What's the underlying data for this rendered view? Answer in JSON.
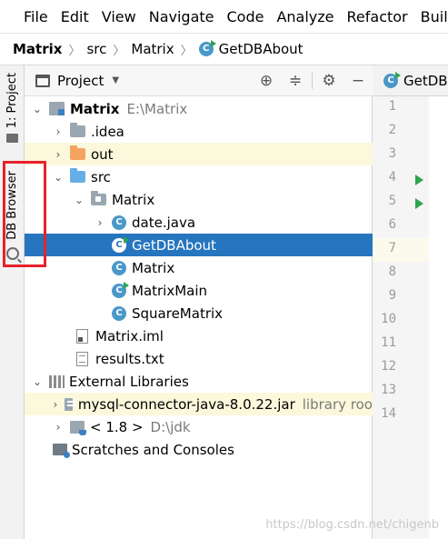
{
  "menubar": {
    "items": [
      {
        "label": "File"
      },
      {
        "label": "Edit"
      },
      {
        "label": "View"
      },
      {
        "label": "Navigate"
      },
      {
        "label": "Code"
      },
      {
        "label": "Analyze"
      },
      {
        "label": "Refactor"
      },
      {
        "label": "Build"
      }
    ]
  },
  "breadcrumb": {
    "items": [
      "Matrix",
      "src",
      "Matrix",
      "GetDBAbout"
    ]
  },
  "toolstrip": {
    "project_tab": "1: Project",
    "db_tab": "DB Browser"
  },
  "project_panel": {
    "title": "Project",
    "tree": [
      {
        "label": "Matrix",
        "detail": "E:\\Matrix"
      },
      {
        "label": ".idea"
      },
      {
        "label": "out"
      },
      {
        "label": "src"
      },
      {
        "label": "Matrix"
      },
      {
        "label": "date.java"
      },
      {
        "label": "GetDBAbout"
      },
      {
        "label": "Matrix"
      },
      {
        "label": "MatrixMain"
      },
      {
        "label": "SquareMatrix"
      },
      {
        "label": "Matrix.iml"
      },
      {
        "label": "results.txt"
      },
      {
        "label": "External Libraries"
      },
      {
        "label": "mysql-connector-java-8.0.22.jar",
        "detail": "library roo"
      },
      {
        "label": "< 1.8 >",
        "detail": "D:\\jdk"
      },
      {
        "label": "Scratches and Consoles"
      }
    ]
  },
  "editor": {
    "tab_label": "GetDBAbout",
    "line_numbers": [
      "1",
      "2",
      "3",
      "4",
      "5",
      "6",
      "7",
      "8",
      "9",
      "10",
      "11",
      "12",
      "13",
      "14"
    ]
  },
  "watermark": "https://blog.csdn.net/chigenb",
  "colors": {
    "selection": "#2675bf",
    "highlight_box": "#e8212b",
    "run_marker": "#2ea44f"
  }
}
